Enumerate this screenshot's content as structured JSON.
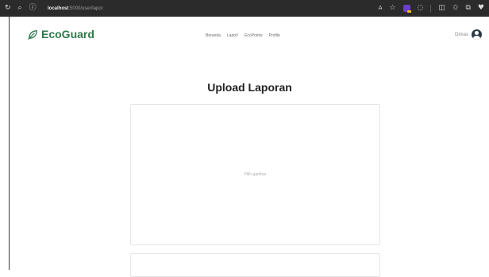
{
  "browser": {
    "url_host": "localhost",
    "url_path": ":5000/user/lapor",
    "icons": {
      "reload": "reload-icon",
      "search": "search-icon",
      "info": "info-icon",
      "read_aloud": "read-aloud-icon",
      "favorite": "star-icon",
      "extension": "extension-icon",
      "copilot": "copilot-icon",
      "split": "split-screen-icon",
      "favorites": "favorites-icon",
      "collections": "collections-icon",
      "heart": "heart-icon"
    },
    "read_aloud_text": "A",
    "background": "#2b2b2b"
  },
  "navbar": {
    "brand": "EcoGuard",
    "brand_color": "#2d7a4a",
    "links": [
      "Beranda",
      "Lapor!",
      "EcoPoints",
      "Profile"
    ],
    "user_name": "Dimas"
  },
  "main": {
    "title": "Upload Laporan",
    "upload_label": "Pilih gambar"
  }
}
